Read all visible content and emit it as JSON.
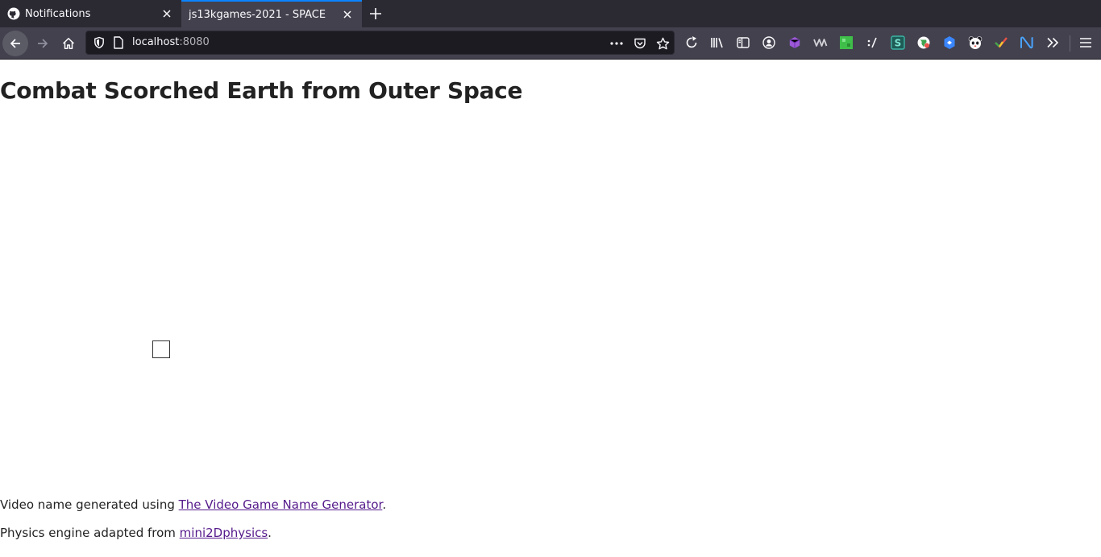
{
  "browser": {
    "tabs": [
      {
        "title": "Notifications",
        "favicon": "github-icon",
        "active": false
      },
      {
        "title": "js13kgames-2021 - SPACE",
        "favicon": "none",
        "active": true
      }
    ],
    "url": {
      "host": "localhost",
      "port": ":8080"
    },
    "toolbar_icons": [
      "library-icon",
      "sidebar-icon",
      "account-icon",
      "cube-extension-icon",
      "wave-extension-icon",
      "green-extension-icon",
      "slash-extension-icon",
      "s-extension-icon",
      "globe-extension-icon",
      "hexagon-extension-icon",
      "panda-extension-icon",
      "check-extension-icon",
      "n-extension-icon",
      "overflow-icon",
      "menu-icon"
    ],
    "accent_color": "#0a84ff"
  },
  "page": {
    "title": "Combat Scorched Earth from Outer Space",
    "credits": [
      {
        "prefix": "Video name generated using ",
        "link": "The Video Game Name Generator",
        "suffix": "."
      },
      {
        "prefix": "Physics engine adapted from ",
        "link": "mini2Dphysics",
        "suffix": "."
      }
    ],
    "link_color": "#551a8b"
  }
}
